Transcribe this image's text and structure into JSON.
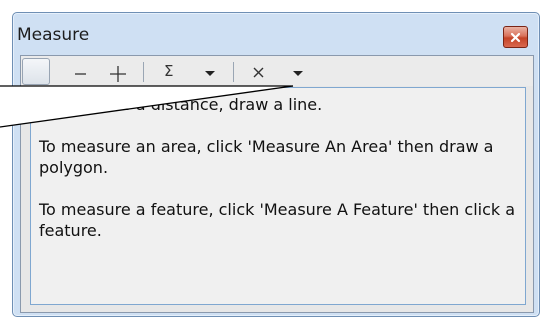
{
  "window": {
    "title": "Measure"
  },
  "toolbar": {
    "icons": [
      "measure-line-icon",
      "measure-area-icon",
      "measure-feature-icon",
      "sum-icon",
      "units-dropdown-icon",
      "clear-icon",
      "clear-dropdown-icon"
    ]
  },
  "instructions": {
    "line": "To measure a distance, draw a line.",
    "area": "To measure an area, click 'Measure An Area' then draw a polygon.",
    "feature": "To measure a feature, click 'Measure A Feature' then click a feature."
  },
  "colors": {
    "window_frame": "#cfe0f3",
    "close_button": "#c44327",
    "panel": "#e7e7e7",
    "content_border": "#7fa7d0"
  }
}
